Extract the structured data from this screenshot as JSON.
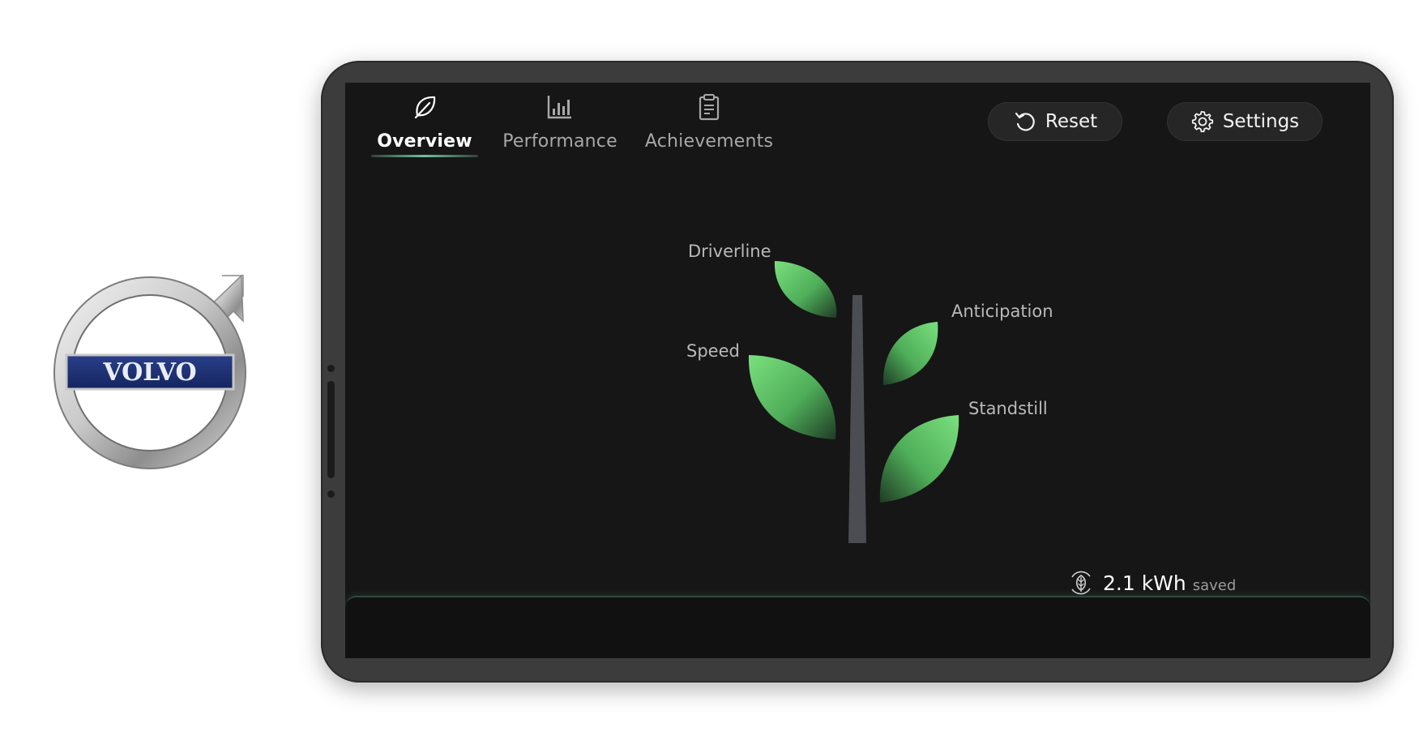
{
  "logo": {
    "brand_text": "VOLVO"
  },
  "tabs": [
    {
      "label": "Overview",
      "icon": "leaf-icon",
      "active": true
    },
    {
      "label": "Performance",
      "icon": "bar-chart-icon",
      "active": false
    },
    {
      "label": "Achievements",
      "icon": "clipboard-icon",
      "active": false
    }
  ],
  "actions": {
    "reset_label": "Reset",
    "reset_icon": "undo-icon",
    "settings_label": "Settings",
    "settings_icon": "gear-icon"
  },
  "tree": {
    "leaves": [
      {
        "label": "Driverline"
      },
      {
        "label": "Speed"
      },
      {
        "label": "Anticipation"
      },
      {
        "label": "Standstill"
      }
    ],
    "leaf_color": "#6cd675",
    "trunk_color": "#4a4d52"
  },
  "savings": {
    "value": "2.1 kWh",
    "label": "saved",
    "icon": "eco-leaf-cycle-icon"
  },
  "colors": {
    "accent": "#6ec39a",
    "screen_bg": "#161616",
    "frame": "#3c3c3c"
  }
}
